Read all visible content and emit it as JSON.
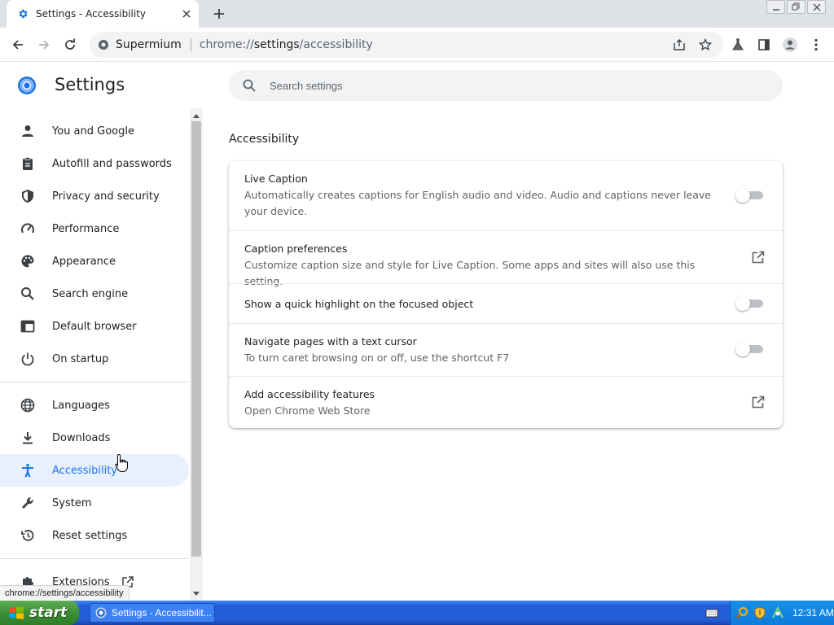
{
  "browser": {
    "tab_title": "Settings - Accessibility",
    "site_name": "Supermium",
    "url_scheme": "chrome://",
    "url_host": "settings",
    "url_path": "/accessibility"
  },
  "settings": {
    "title": "Settings",
    "search_placeholder": "Search settings",
    "nav": [
      {
        "label": "You and Google",
        "icon": "person-icon"
      },
      {
        "label": "Autofill and passwords",
        "icon": "clipboard-icon"
      },
      {
        "label": "Privacy and security",
        "icon": "shield-icon"
      },
      {
        "label": "Performance",
        "icon": "speedometer-icon"
      },
      {
        "label": "Appearance",
        "icon": "palette-icon"
      },
      {
        "label": "Search engine",
        "icon": "search-icon"
      },
      {
        "label": "Default browser",
        "icon": "browser-window-icon"
      },
      {
        "label": "On startup",
        "icon": "power-icon"
      },
      {
        "label": "Languages",
        "icon": "globe-icon"
      },
      {
        "label": "Downloads",
        "icon": "download-icon"
      },
      {
        "label": "Accessibility",
        "icon": "accessibility-icon"
      },
      {
        "label": "System",
        "icon": "wrench-icon"
      },
      {
        "label": "Reset settings",
        "icon": "history-icon"
      },
      {
        "label": "Extensions",
        "icon": "puzzle-icon"
      }
    ],
    "active_nav": "Accessibility",
    "section_title": "Accessibility",
    "rows": [
      {
        "title": "Live Caption",
        "subtitle": "Automatically creates captions for English audio and video. Audio and captions never leave your device.",
        "control": "toggle",
        "enabled": false
      },
      {
        "title": "Caption preferences",
        "subtitle": "Customize caption size and style for Live Caption. Some apps and sites will also use this setting.",
        "control": "external-link"
      },
      {
        "title": "Show a quick highlight on the focused object",
        "subtitle": "",
        "control": "toggle",
        "enabled": false
      },
      {
        "title": "Navigate pages with a text cursor",
        "subtitle": "To turn caret browsing on or off, use the shortcut F7",
        "control": "toggle",
        "enabled": false
      },
      {
        "title": "Add accessibility features",
        "subtitle": "Open Chrome Web Store",
        "control": "external-link"
      }
    ]
  },
  "status_bubble": "chrome://settings/accessibility",
  "taskbar": {
    "start_label": "start",
    "task_label": "Settings - Accessibilit...",
    "clock": "12:31 AM"
  },
  "colors": {
    "accent": "#1a73e8",
    "active_nav_bg": "#e8f0fe",
    "taskbar_blue": "#245edb",
    "start_green": "#3c8f36"
  }
}
